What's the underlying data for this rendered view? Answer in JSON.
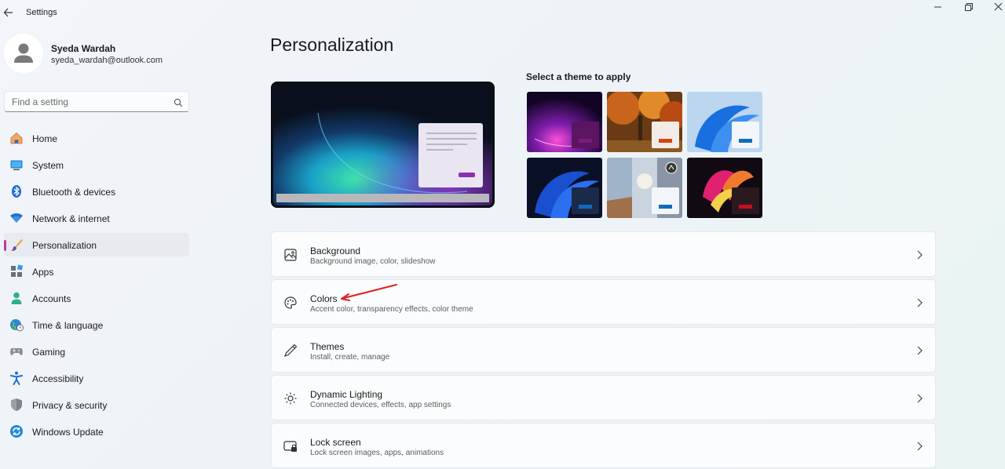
{
  "window": {
    "title": "Settings"
  },
  "profile": {
    "name": "Syeda Wardah",
    "email": "syeda_wardah@outlook.com"
  },
  "search": {
    "placeholder": "Find a setting",
    "value": ""
  },
  "sidebar": {
    "items": [
      {
        "label": "Home",
        "icon": "home-icon",
        "active": false
      },
      {
        "label": "System",
        "icon": "system-icon",
        "active": false
      },
      {
        "label": "Bluetooth & devices",
        "icon": "bluetooth-icon",
        "active": false
      },
      {
        "label": "Network & internet",
        "icon": "wifi-icon",
        "active": false
      },
      {
        "label": "Personalization",
        "icon": "brush-icon",
        "active": true
      },
      {
        "label": "Apps",
        "icon": "apps-icon",
        "active": false
      },
      {
        "label": "Accounts",
        "icon": "person-icon",
        "active": false
      },
      {
        "label": "Time & language",
        "icon": "globe-icon",
        "active": false
      },
      {
        "label": "Gaming",
        "icon": "gamepad-icon",
        "active": false
      },
      {
        "label": "Accessibility",
        "icon": "accessibility-icon",
        "active": false
      },
      {
        "label": "Privacy & security",
        "icon": "shield-icon",
        "active": false
      },
      {
        "label": "Windows Update",
        "icon": "update-icon",
        "active": false
      }
    ]
  },
  "main": {
    "title": "Personalization",
    "themes_label": "Select a theme to apply",
    "themes": [
      {
        "name": "purple-glow",
        "accent": "#6a1268"
      },
      {
        "name": "autumn-forest",
        "accent": "#d84315"
      },
      {
        "name": "light-bloom",
        "accent": "#0f6cbd"
      },
      {
        "name": "dark-bloom",
        "accent": "#0f6cbd"
      },
      {
        "name": "flowers-spotlight",
        "accent": "#0f6cbd"
      },
      {
        "name": "captured-motion",
        "accent": "#c50f1f"
      }
    ],
    "settings": [
      {
        "title": "Background",
        "subtitle": "Background image, color, slideshow",
        "icon": "image-icon"
      },
      {
        "title": "Colors",
        "subtitle": "Accent color, transparency effects, color theme",
        "icon": "palette-icon"
      },
      {
        "title": "Themes",
        "subtitle": "Install, create, manage",
        "icon": "pen-icon"
      },
      {
        "title": "Dynamic Lighting",
        "subtitle": "Connected devices, effects, app settings",
        "icon": "lighting-icon"
      },
      {
        "title": "Lock screen",
        "subtitle": "Lock screen images, apps, animations",
        "icon": "lock-screen-icon"
      }
    ]
  },
  "colors": {
    "active_indicator": "#c23aa0",
    "annotation_arrow": "#e02020",
    "accent_blue": "#0f6cbd"
  }
}
